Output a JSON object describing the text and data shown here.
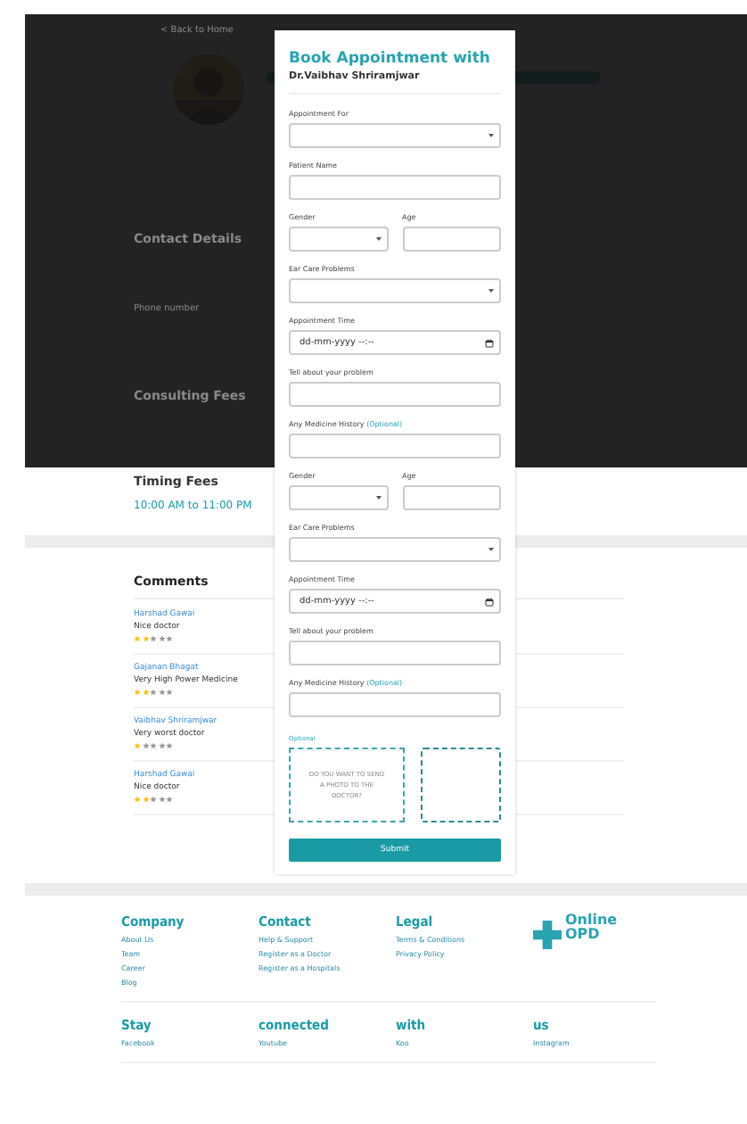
{
  "background": {
    "back_link": "< Back to Home",
    "contact_heading": "Contact Details",
    "phone_label": "Phone number",
    "fees_heading": "Consulting Fees",
    "timing_heading": "Timing Fees",
    "timing_value": "10:00 AM to 11:00 PM"
  },
  "comments": {
    "heading": "Comments",
    "items": [
      {
        "name": "Harshad Gawai",
        "text": "Nice doctor",
        "stars": 2
      },
      {
        "name": "Gajanan Bhagat",
        "text": "Very High Power Medicine",
        "stars": 2
      },
      {
        "name": "Vaibhav Shriramjwar",
        "text": "Very worst doctor",
        "stars": 1
      },
      {
        "name": "Harshad Gawai",
        "text": "Nice doctor",
        "stars": 2
      }
    ]
  },
  "modal": {
    "title": "Book Appointment with",
    "doctor": "Dr.Vaibhav Shriramjwar",
    "fields": [
      {
        "kind": "select",
        "label": "Appointment For"
      },
      {
        "kind": "text",
        "label": "Patient Name"
      },
      {
        "kind": "pair",
        "left": "Gender",
        "right": "Age"
      },
      {
        "kind": "select",
        "label": "Ear Care Problems"
      },
      {
        "kind": "datetime",
        "label": "Appointment Time",
        "placeholder": "dd-mm-yyyy --:--"
      },
      {
        "kind": "text",
        "label": "Tell about your problem"
      },
      {
        "kind": "text",
        "label": "Any Medicine History",
        "note": "(Optional)"
      },
      {
        "kind": "pair",
        "left": "Gender",
        "right": "Age"
      },
      {
        "kind": "select",
        "label": "Ear Care Problems"
      },
      {
        "kind": "datetime",
        "label": "Appointment Time",
        "placeholder": "dd-mm-yyyy --:--"
      },
      {
        "kind": "text",
        "label": "Tell about your problem"
      },
      {
        "kind": "text",
        "label": "Any Medicine History",
        "note": "(Optional)"
      }
    ],
    "upload": {
      "label": "Optional",
      "prompt": "DO YOU WANT TO SEND A PHOTO TO THE DOCTOR?"
    },
    "submit": "Submit"
  },
  "footer": {
    "columns": [
      {
        "heading": "Company",
        "links": [
          "About Us",
          "Team",
          "Career",
          "Blog"
        ]
      },
      {
        "heading": "Contact",
        "links": [
          "Help & Support",
          "Register as a Doctor",
          "Register as a Hospitals"
        ]
      },
      {
        "heading": "Legal",
        "links": [
          "Terms & Conditions",
          "Privacy Policy"
        ]
      }
    ],
    "logo": {
      "line1": "Online",
      "line2": "OPD"
    },
    "social": [
      {
        "heading": "Stay",
        "link": "Facebook"
      },
      {
        "heading": "connected",
        "link": "Youtube"
      },
      {
        "heading": "with",
        "link": "Koo"
      },
      {
        "heading": "us",
        "link": "Instagram"
      }
    ]
  }
}
